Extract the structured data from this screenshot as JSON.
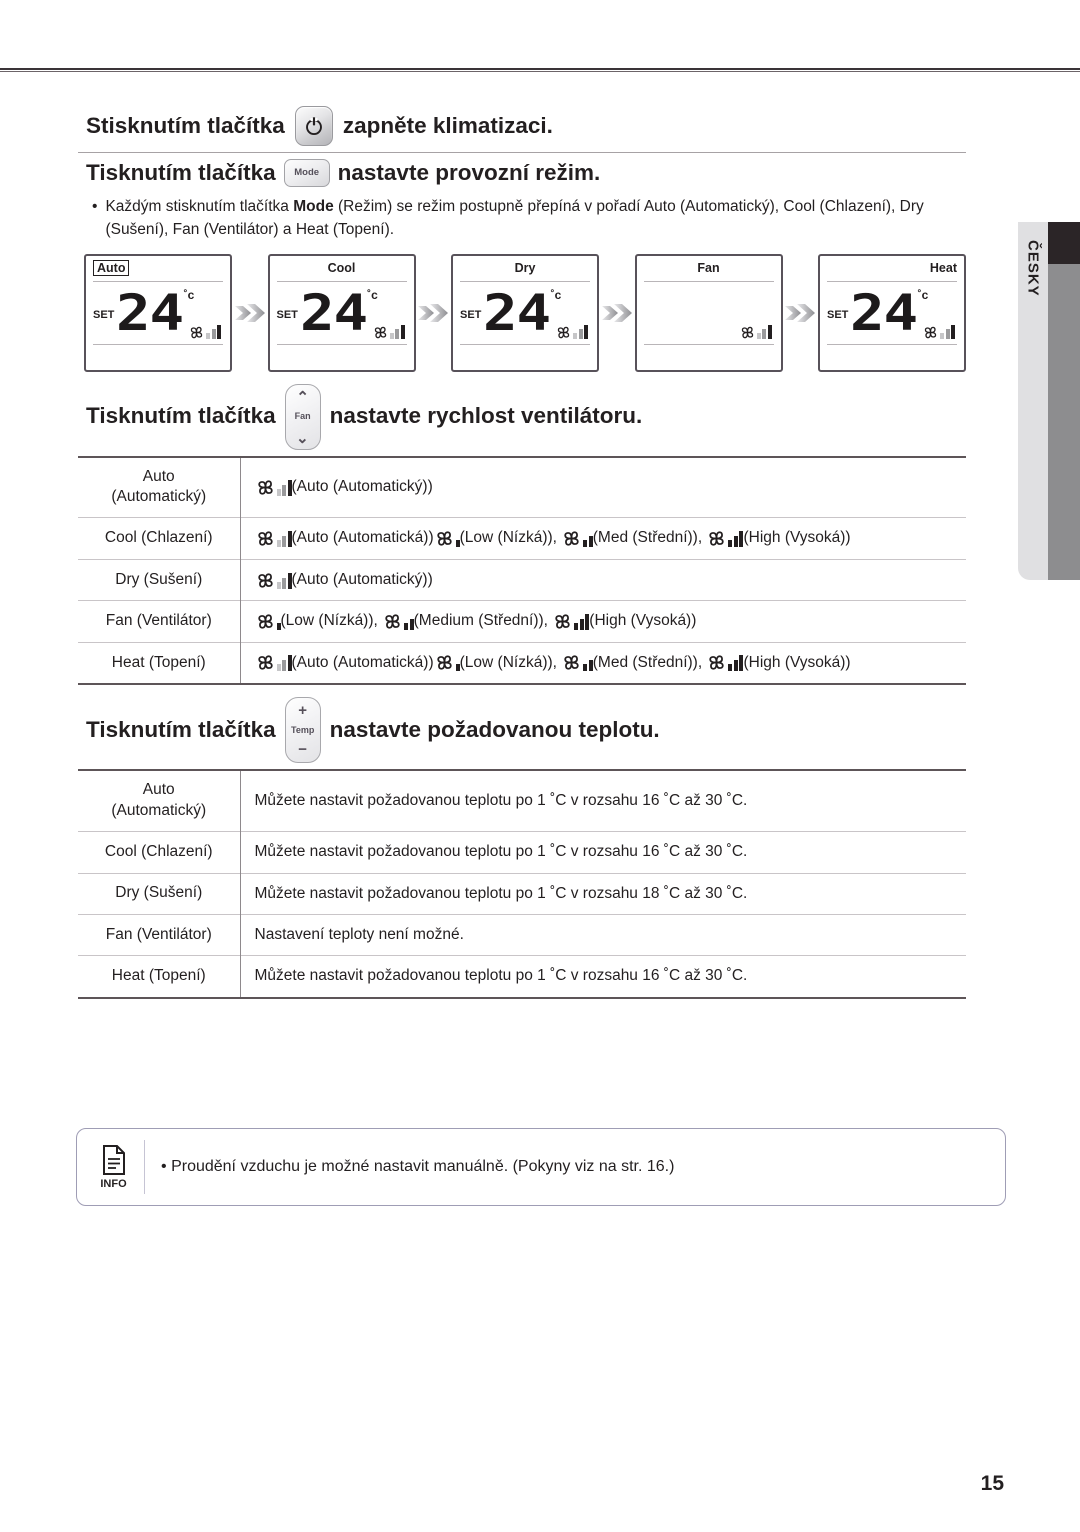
{
  "document": {
    "page_number": "15",
    "language_tab": "ČESKY"
  },
  "sections": {
    "power": {
      "text_before": "Stisknutím tlačítka",
      "button_label": "power-icon",
      "text_after": "zapněte klimatizaci."
    },
    "mode": {
      "text_before": "Tisknutím tlačítka",
      "button_label": "Mode",
      "text_after": "nastavte provozní režim.",
      "bullet": "Každým stisknutím tlačítka Mode (Režim) se režim postupně přepíná v pořadí Auto (Automatický), Cool (Chlazení), Dry (Sušení), Fan (Ventilátor) a Heat (Topení).",
      "bullet_parts": {
        "lead": "Každým stisknutím tlačítka ",
        "bold": "Mode",
        "rest": " (Režim) se režim postupně přepíná v pořadí Auto (Automatický), Cool (Chlazení), Dry (Sušení), Fan (Ventilátor) a Heat (Topení)."
      },
      "displays": [
        {
          "mode": "Auto",
          "align": "left",
          "boxed": true,
          "set": "SET",
          "temp": "24",
          "unit": "˚c",
          "fan": "auto"
        },
        {
          "mode": "Cool",
          "align": "center",
          "boxed": false,
          "set": "SET",
          "temp": "24",
          "unit": "˚c",
          "fan": "auto"
        },
        {
          "mode": "Dry",
          "align": "center",
          "boxed": false,
          "set": "SET",
          "temp": "24",
          "unit": "˚c",
          "fan": "auto"
        },
        {
          "mode": "Fan",
          "align": "center",
          "boxed": false,
          "set": "",
          "temp": "",
          "unit": "",
          "fan": "auto"
        },
        {
          "mode": "Heat",
          "align": "right",
          "boxed": false,
          "set": "SET",
          "temp": "24",
          "unit": "˚c",
          "fan": "auto"
        }
      ]
    },
    "fan_speed": {
      "text_before": "Tisknutím tlačítka",
      "button_label": "Fan",
      "button_up": "up-chevron",
      "button_down": "down-chevron",
      "text_after": "nastavte rychlost ventilátoru.",
      "rows": [
        {
          "mode": "Auto\n(Automatický)",
          "mode_line1": "Auto",
          "mode_line2": "(Automatický)",
          "options": [
            {
              "icon": "auto",
              "label": "(Auto (Automatický))"
            }
          ]
        },
        {
          "mode_line1": "Cool (Chlazení)",
          "mode_line2": "",
          "options": [
            {
              "icon": "auto",
              "label": "(Auto (Automatická))"
            },
            {
              "icon": "low",
              "label": "(Low (Nízká)), "
            },
            {
              "icon": "med",
              "label": "(Med (Střední)), "
            },
            {
              "icon": "high",
              "label": "(High (Vysoká))"
            }
          ]
        },
        {
          "mode_line1": "Dry (Sušení)",
          "mode_line2": "",
          "options": [
            {
              "icon": "auto",
              "label": "(Auto (Automatický))"
            }
          ]
        },
        {
          "mode_line1": "Fan (Ventilátor)",
          "mode_line2": "",
          "options": [
            {
              "icon": "low",
              "label": "(Low (Nízká)), "
            },
            {
              "icon": "med",
              "label": "(Medium (Střední)), "
            },
            {
              "icon": "high",
              "label": "(High (Vysoká))"
            }
          ]
        },
        {
          "mode_line1": "Heat (Topení)",
          "mode_line2": "",
          "options": [
            {
              "icon": "auto",
              "label": "(Auto (Automatická))"
            },
            {
              "icon": "low",
              "label": "(Low (Nízká)), "
            },
            {
              "icon": "med",
              "label": "(Med (Střední)), "
            },
            {
              "icon": "high",
              "label": "(High (Vysoká))"
            }
          ]
        }
      ]
    },
    "temperature": {
      "text_before": "Tisknutím tlačítka",
      "button_label": "Temp",
      "button_up": "+",
      "button_down": "−",
      "text_after": "nastavte požadovanou teplotu.",
      "rows": [
        {
          "mode_line1": "Auto",
          "mode_line2": "(Automatický)",
          "desc": "Můžete nastavit požadovanou teplotu po 1 ˚C v rozsahu 16 ˚C až 30 ˚C."
        },
        {
          "mode_line1": "Cool (Chlazení)",
          "mode_line2": "",
          "desc": "Můžete nastavit požadovanou teplotu po 1 ˚C v rozsahu 16 ˚C až 30 ˚C."
        },
        {
          "mode_line1": "Dry (Sušení)",
          "mode_line2": "",
          "desc": "Můžete nastavit požadovanou teplotu po 1 ˚C v rozsahu 18 ˚C až 30 ˚C."
        },
        {
          "mode_line1": "Fan (Ventilátor)",
          "mode_line2": "",
          "desc": "Nastavení teploty není možné."
        },
        {
          "mode_line1": "Heat (Topení)",
          "mode_line2": "",
          "desc": "Můžete nastavit požadovanou teplotu po 1 ˚C v rozsahu 16 ˚C až 30 ˚C."
        }
      ]
    },
    "info": {
      "icon_label": "INFO",
      "bullet": "•",
      "text": "Proudění vzduchu je možné nastavit manuálně. (Pokyny viz na str. 16.)"
    }
  },
  "colors": {
    "text": "#231f20",
    "rule_dark": "#3a3438",
    "rule_light": "#c9c5c8",
    "lcd_border": "#58525a",
    "info_border": "#9f9db5",
    "tab_bg": "#e0e0e2",
    "bar_gray_light": "#c6c6c8",
    "bar_gray_mid": "#9a9a9c",
    "bar_black": "#231f20"
  }
}
